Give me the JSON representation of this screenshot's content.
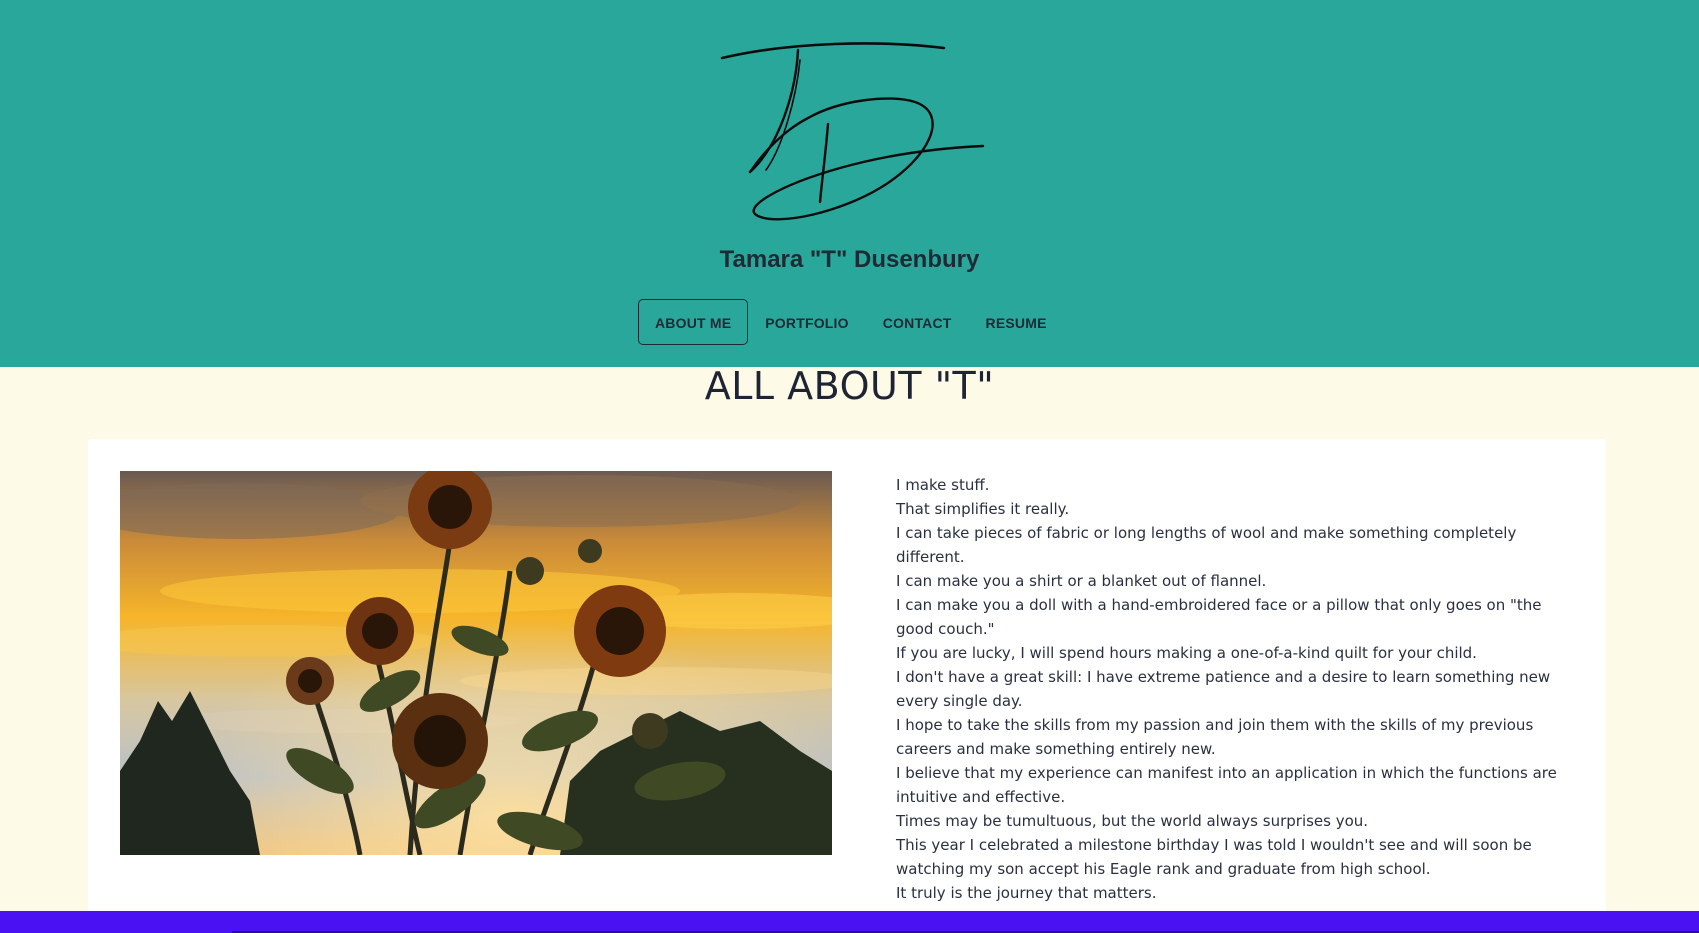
{
  "site": {
    "logo_icon": "signature-logo-icon",
    "name": "Tamara \"T\" Dusenbury"
  },
  "nav": {
    "items": [
      {
        "label": "ABOUT ME",
        "active": true
      },
      {
        "label": "PORTFOLIO",
        "active": false
      },
      {
        "label": "CONTACT",
        "active": false
      },
      {
        "label": "RESUME",
        "active": false
      }
    ]
  },
  "main": {
    "title": "ALL ABOUT \"T\"",
    "photo_icon": "sunflowers-sunset-photo",
    "bio": [
      "I make stuff.",
      "That simplifies it really.",
      "I can take pieces of fabric or long lengths of wool and make something completely different.",
      "I can make you a shirt or a blanket out of flannel.",
      "I can make you a doll with a hand-embroidered face or a pillow that only goes on \"the good couch.\"",
      "If you are lucky, I will spend hours making a one-of-a-kind quilt for your child.",
      "I don't have a great skill: I have extreme patience and a desire to learn something new every single day.",
      "I hope to take the skills from my passion and join them with the skills of my previous careers and make something entirely new.",
      "I believe that my experience can manifest into an application in which the functions are intuitive and effective.",
      "Times may be tumultuous, but the world always surprises you.",
      "This year I celebrated a milestone birthday I was told I wouldn't see and will soon be watching my son accept his Eagle rank and graduate from high school.",
      "It truly is the journey that matters."
    ]
  },
  "colors": {
    "header_bg": "#2aa79b",
    "page_bg": "#fefae8",
    "footer_bg": "#4a12f2",
    "text": "#1e2433"
  }
}
